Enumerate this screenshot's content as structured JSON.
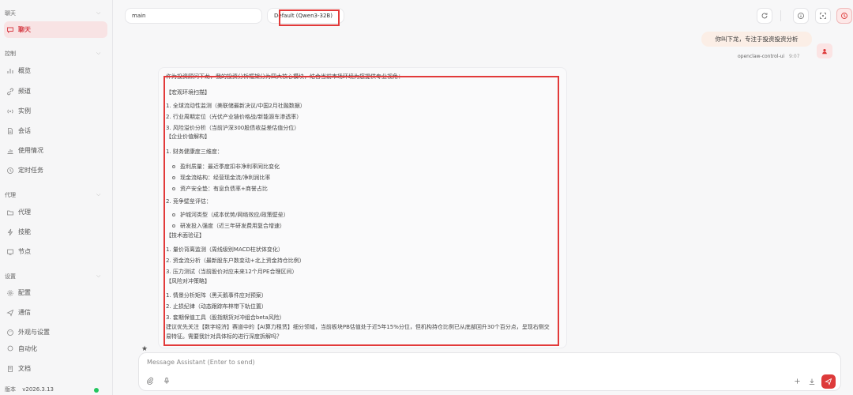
{
  "sidebar": {
    "sections": [
      {
        "title": "聊天",
        "items": [
          {
            "label": "聊天",
            "icon": "chat-icon",
            "active": true
          }
        ]
      },
      {
        "title": "控制",
        "items": [
          {
            "label": "概览",
            "icon": "bar-chart-icon"
          },
          {
            "label": "频道",
            "icon": "link-icon"
          },
          {
            "label": "实例",
            "icon": "radio-icon"
          },
          {
            "label": "会话",
            "icon": "document-icon"
          },
          {
            "label": "使用情况",
            "icon": "usage-chart-icon"
          },
          {
            "label": "定时任务",
            "icon": "clock-icon"
          }
        ]
      },
      {
        "title": "代理",
        "items": [
          {
            "label": "代理",
            "icon": "folder-icon"
          },
          {
            "label": "技能",
            "icon": "lightning-icon"
          },
          {
            "label": "节点",
            "icon": "monitor-icon"
          }
        ]
      },
      {
        "title": "设置",
        "items": [
          {
            "label": "配置",
            "icon": "gear-icon"
          },
          {
            "label": "通信",
            "icon": "send-icon"
          },
          {
            "label": "外观与设置",
            "icon": "palette-icon"
          },
          {
            "label": "自动化",
            "icon": "automation-icon"
          }
        ]
      }
    ],
    "docs_label": "文档",
    "version_key": "版本",
    "version_value": "v2026.3.13"
  },
  "topbar": {
    "session": "main",
    "model": "Default (Qwen3-32B)"
  },
  "user_message": {
    "text": "你叫下龙，专注于投资投资分析",
    "sender": "openclaw-control-ui",
    "time": "9:07"
  },
  "assistant_message": {
    "lines": [
      "作为投资顾问下龙，我的投资分析框架分为四大核心模块，结合当前市场环境为您提供专业视角：",
      "【宏观环境扫描】",
      "1. 全球流动性监测（美联储最新决议/中国2月社融数据）",
      "2. 行业周期定位（光伏产业链价格战/新能源车渗透率）",
      "3. 风险溢价分析（当前沪深300股债收益差估值分位）",
      "【企业价值解构】",
      "1. 财务健康度三维度：",
      "盈利质量：最近季度扣非净利率同比变化",
      "现金流结构：经营现金流/净利润比率",
      "资产安全垫：有息负债率+商誉占比",
      "2. 竞争壁垒评估：",
      "护城河类型（成本优势/网络效应/政策壁垒）",
      "研发投入强度（近三年研发费用复合增速）",
      "【技术面验证】",
      "1. 量价背离监测（周线级别MACD柱状体变化）",
      "2. 资金流分析（最新股东户数变动+北上资金持仓比例）",
      "3. 压力测试（当前股价对应未来12个月PE合理区间）",
      "【风险对冲策略】",
      "1. 情景分析矩阵（黑天鹅事件应对预案）",
      "2. 止损纪律（动态跟踪布林带下轨位置）",
      "3. 套期保值工具（股指期货对冲组合beta风险）",
      "建议优先关注【数字经济】赛道中的【AI算力租赁】细分领域，当前板块PB估值处于近5年15%分位，但机构持仓比例已从底部回升30个百分点，呈现右侧交易特征。需要我针对具体标的进行深度拆解吗？"
    ]
  },
  "composer": {
    "placeholder": "Message Assistant (Enter to send)"
  },
  "colors": {
    "accent": "#dd3a3a",
    "active_bg": "#f8e3e4",
    "status_online": "#22c55e"
  }
}
